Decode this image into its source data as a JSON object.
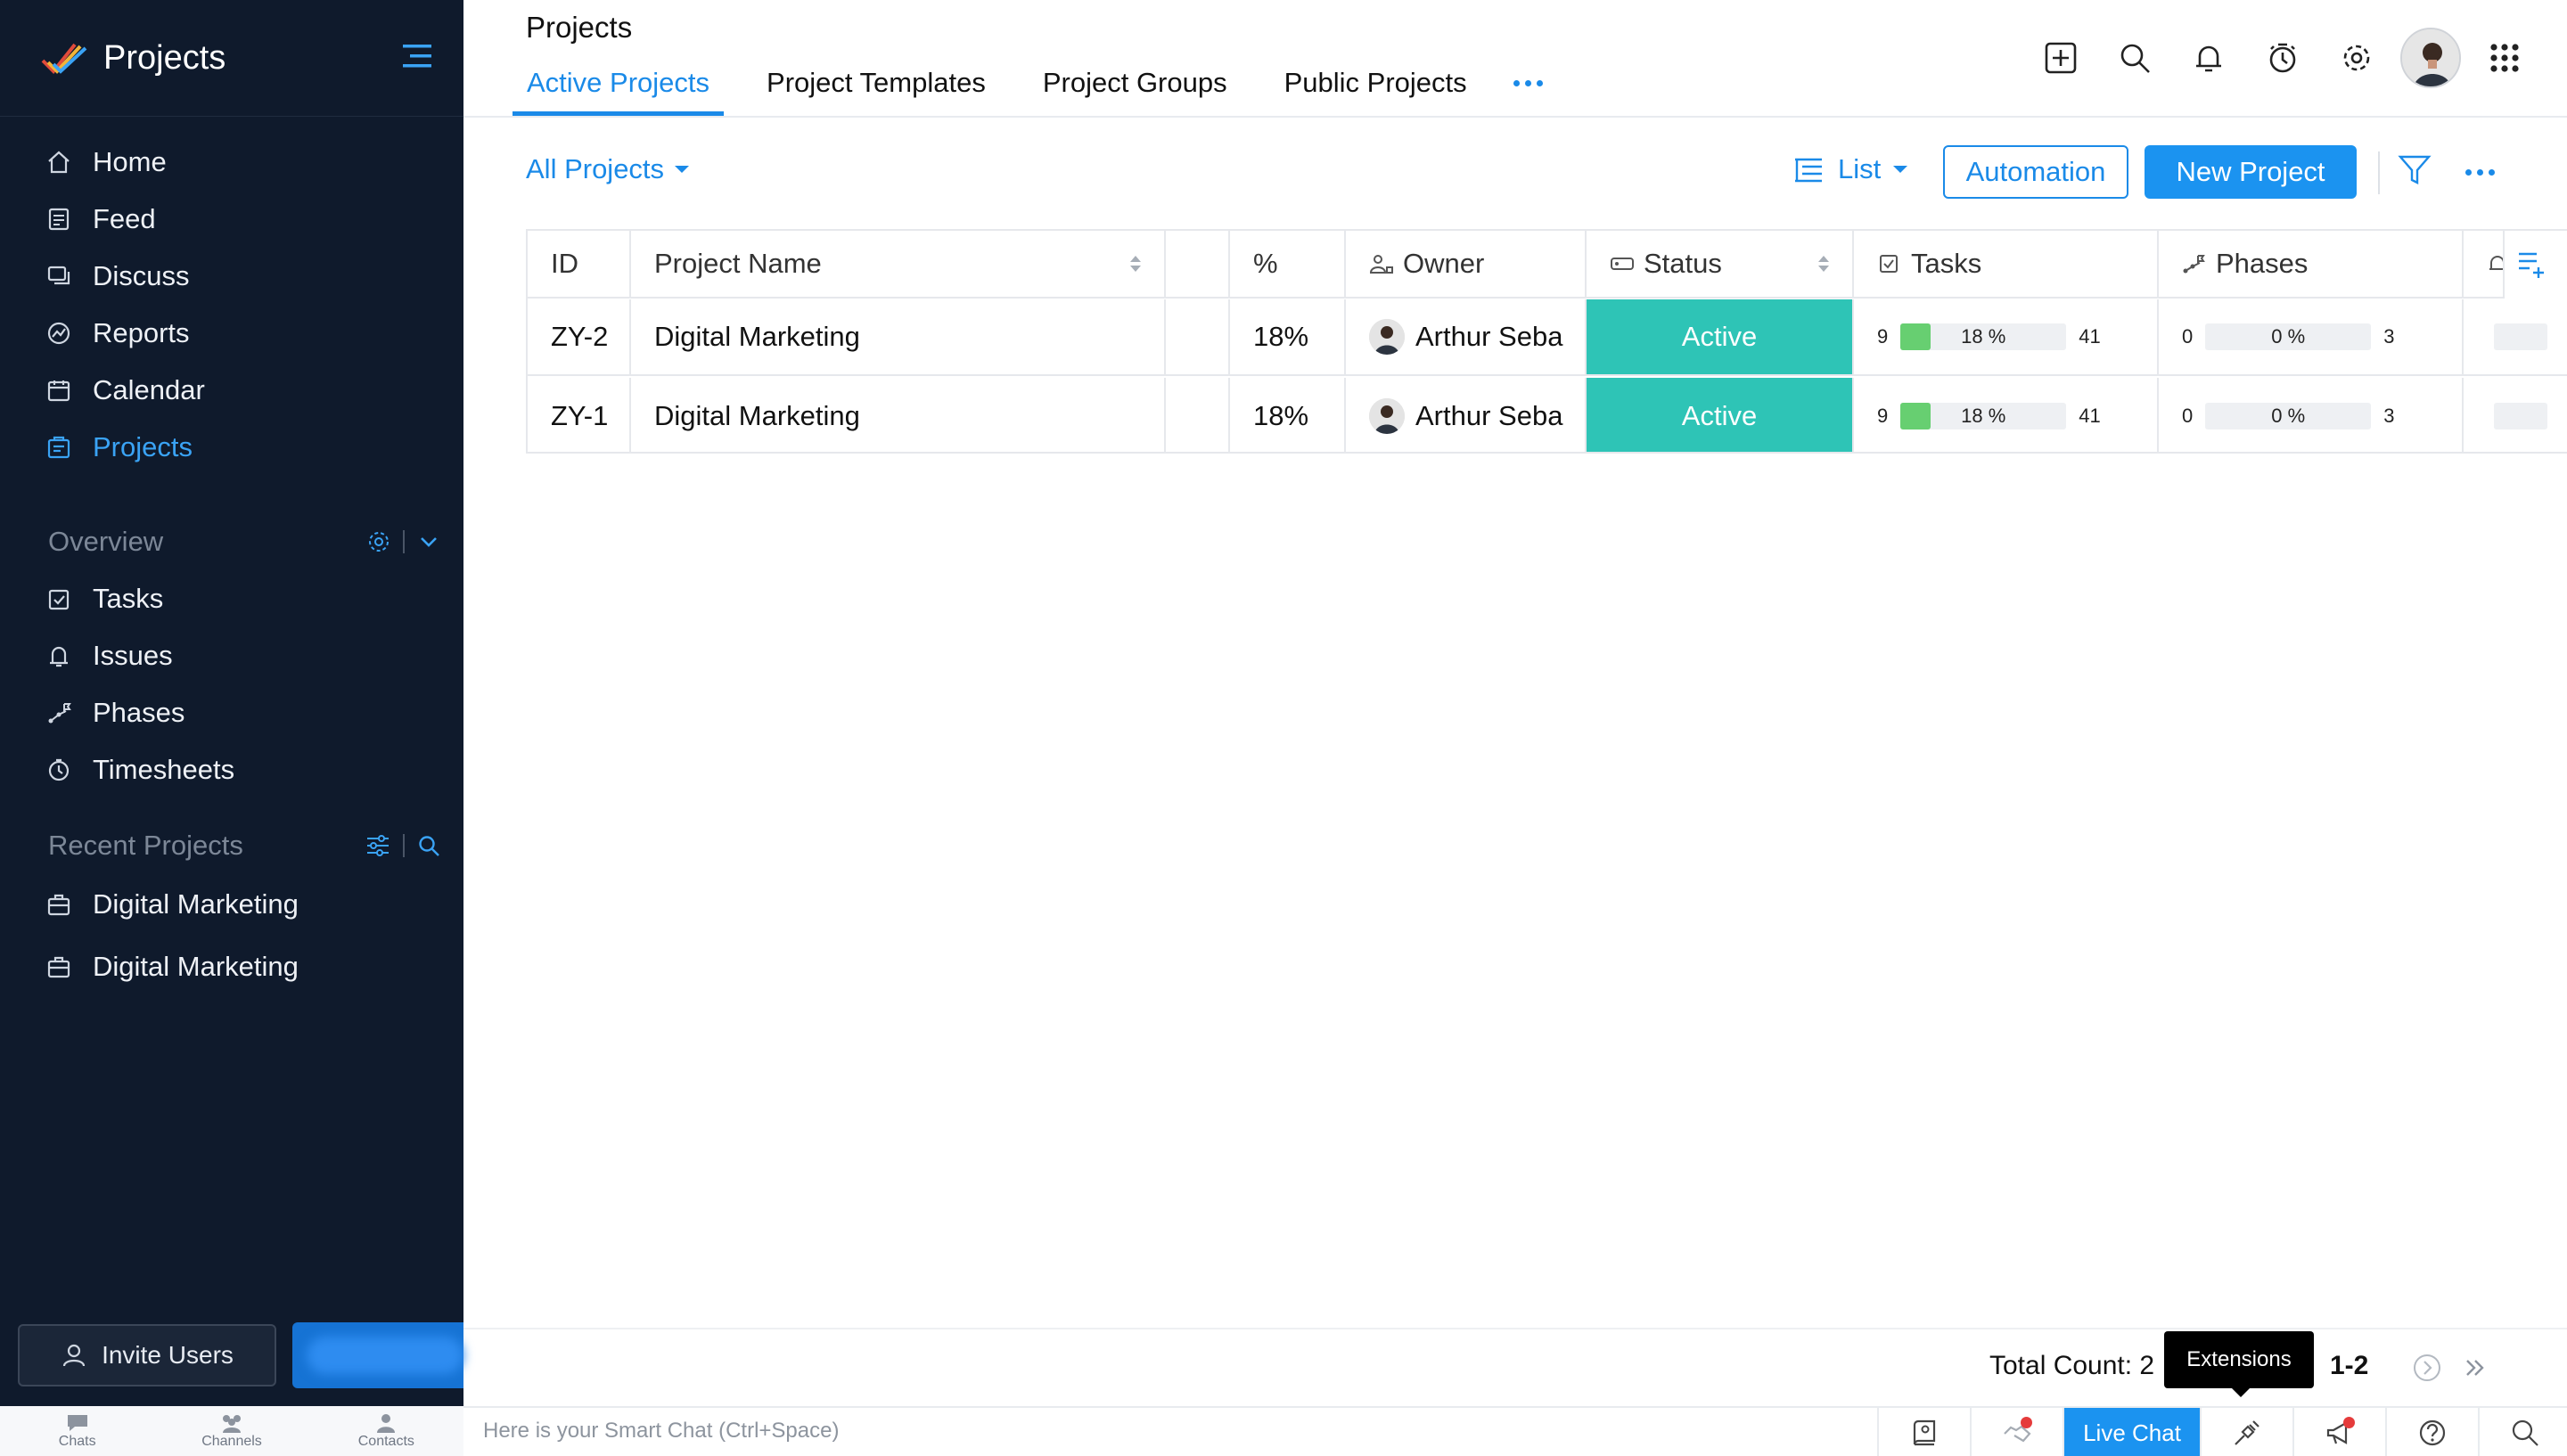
{
  "sidebar": {
    "brand": "Projects",
    "nav": [
      {
        "label": "Home",
        "icon": "home-icon"
      },
      {
        "label": "Feed",
        "icon": "feed-icon"
      },
      {
        "label": "Discuss",
        "icon": "discuss-icon"
      },
      {
        "label": "Reports",
        "icon": "reports-icon"
      },
      {
        "label": "Calendar",
        "icon": "calendar-icon"
      },
      {
        "label": "Projects",
        "icon": "projects-icon",
        "active": true
      }
    ],
    "overview": {
      "title": "Overview",
      "items": [
        {
          "label": "Tasks",
          "icon": "tasks-icon"
        },
        {
          "label": "Issues",
          "icon": "issues-icon"
        },
        {
          "label": "Phases",
          "icon": "phases-icon"
        },
        {
          "label": "Timesheets",
          "icon": "timesheets-icon"
        }
      ]
    },
    "recent": {
      "title": "Recent Projects",
      "items": [
        {
          "label": "Digital Marketing",
          "icon": "briefcase-icon"
        },
        {
          "label": "Digital Marketing",
          "icon": "briefcase-icon"
        }
      ]
    },
    "invite_label": "Invite Users",
    "chatbar": [
      "Chats",
      "Channels",
      "Contacts"
    ]
  },
  "header": {
    "title": "Projects",
    "tabs": [
      {
        "label": "Active Projects",
        "active": true
      },
      {
        "label": "Project Templates"
      },
      {
        "label": "Project Groups"
      },
      {
        "label": "Public Projects"
      }
    ]
  },
  "toolbar": {
    "view_filter": "All Projects",
    "layout": "List",
    "automation": "Automation",
    "new_project": "New Project"
  },
  "table": {
    "columns": {
      "id": "ID",
      "name": "Project Name",
      "pct": "%",
      "owner": "Owner",
      "status": "Status",
      "tasks": "Tasks",
      "phases": "Phases"
    },
    "rows": [
      {
        "id": "ZY-2",
        "name": "Digital Marketing",
        "pct": "18%",
        "owner": "Arthur Seba",
        "status": "Active",
        "tasks_open": "9",
        "tasks_pct_label": "18 %",
        "tasks_pct": 0.18,
        "tasks_closed": "41",
        "phases_open": "0",
        "phases_pct_label": "0 %",
        "phases_pct": 0,
        "phases_closed": "3"
      },
      {
        "id": "ZY-1",
        "name": "Digital Marketing",
        "pct": "18%",
        "owner": "Arthur Seba",
        "status": "Active",
        "tasks_open": "9",
        "tasks_pct_label": "18 %",
        "tasks_pct": 0.18,
        "tasks_closed": "41",
        "phases_open": "0",
        "phases_pct_label": "0 %",
        "phases_pct": 0,
        "phases_closed": "3"
      }
    ]
  },
  "footer": {
    "total_count": "Total Count: 2",
    "range": "1-2",
    "tooltip": "Extensions"
  },
  "smartbar": {
    "placeholder": "Here is your Smart Chat (Ctrl+Space)",
    "live_chat": "Live Chat"
  },
  "colors": {
    "sidebar_bg": "#0f1a2c",
    "accent": "#1a8ae8",
    "status_active": "#2ec4b6",
    "progress_fill": "#67cf71"
  }
}
